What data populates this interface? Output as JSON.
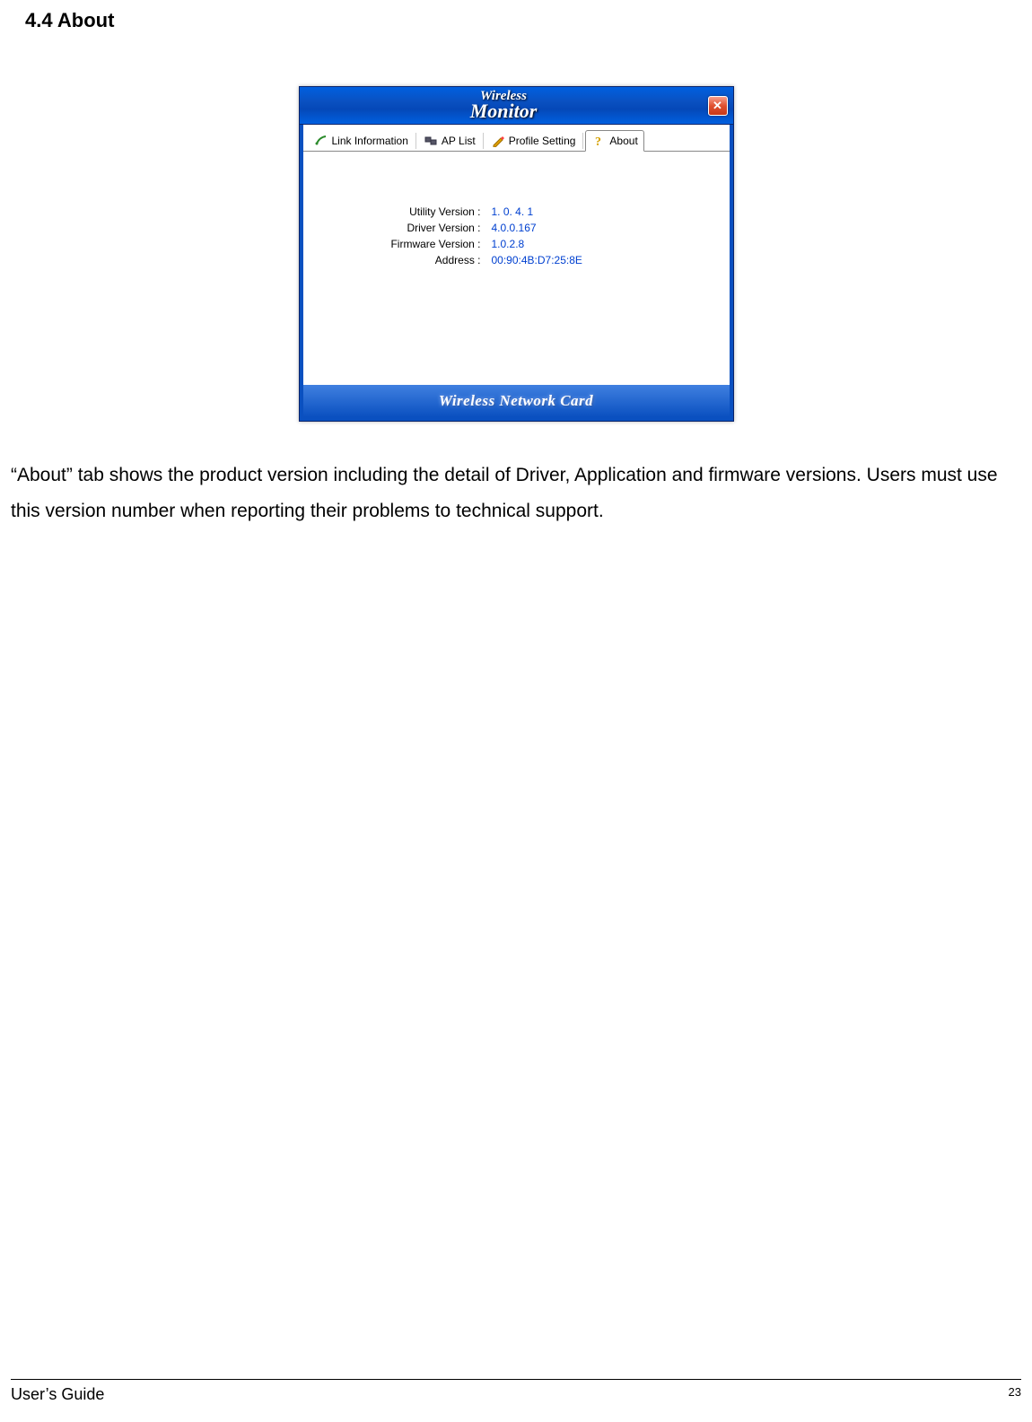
{
  "heading": "4.4 About",
  "window": {
    "logo_top": "Wireless",
    "logo_bottom": "Monitor",
    "close_symbol": "✕",
    "tabs": {
      "link_info": "Link Information",
      "ap_list": "AP List",
      "profile": "Profile Setting",
      "about": "About"
    },
    "info": {
      "utility_label": "Utility Version :",
      "utility_value": "1. 0. 4. 1",
      "driver_label": "Driver Version :",
      "driver_value": "4.0.0.167",
      "firmware_label": "Firmware Version :",
      "firmware_value": "1.0.2.8",
      "address_label": "Address :",
      "address_value": "00:90:4B:D7:25:8E"
    },
    "banner": "Wireless Network Card"
  },
  "body_text": "“About” tab shows the product version including the detail of Driver, Application and firmware versions. Users must use this version number when reporting their problems to technical support.",
  "footer": {
    "left": "User’s Guide",
    "right": "23"
  }
}
